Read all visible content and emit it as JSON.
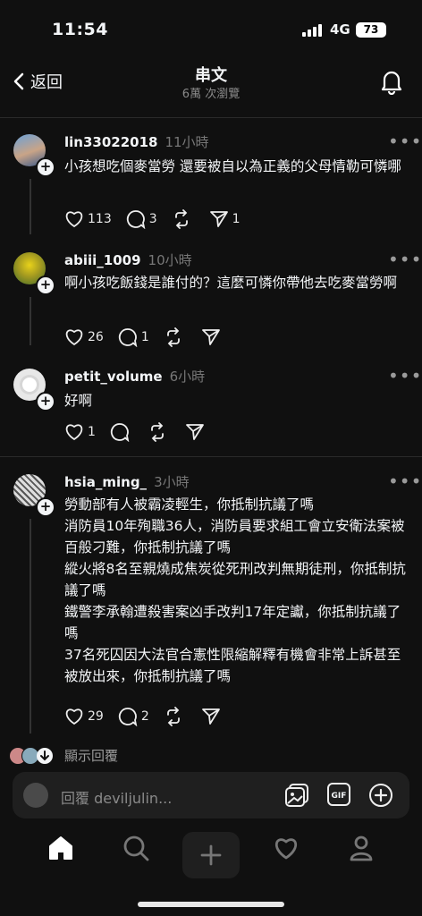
{
  "status_bar": {
    "time": "11:54",
    "network": "4G",
    "battery": "73"
  },
  "header": {
    "back_label": "返回",
    "title": "串文",
    "subtitle": "6萬 次瀏覽"
  },
  "replies": [
    {
      "username": "lin33022018",
      "time": "11小時",
      "text": "小孩想吃個麥當勞 還要被自以為正義的父母情勒可憐哪",
      "likes": "113",
      "comments": "3",
      "reposts": "",
      "shares": "1"
    },
    {
      "username": "abiii_1009",
      "time": "10小時",
      "text": "啊小孩吃飯錢是誰付的？這麼可憐你帶他去吃麥當勞啊",
      "likes": "26",
      "comments": "1",
      "reposts": "",
      "shares": ""
    },
    {
      "username": "petit_volume",
      "time": "6小時",
      "text": "好啊",
      "likes": "1",
      "comments": "",
      "reposts": "",
      "shares": ""
    },
    {
      "username": "hsia_ming_",
      "time": "3小時",
      "lines": [
        "勞動部有人被霸凌輕生，你抵制抗議了嗎",
        "消防員10年殉職36人，消防員要求組工會立安衛法案被百般刁難，你抵制抗議了嗎",
        "縱火將8名至親燒成焦炭從死刑改判無期徒刑，你抵制抗議了嗎",
        "鐵警李承翰遭殺害案凶手改判17年定讞，你抵制抗議了嗎",
        "37名死囚因大法官合憲性限縮解釋有機會非常上訴甚至被放出來，你抵制抗議了嗎"
      ],
      "likes": "29",
      "comments": "2",
      "reposts": "",
      "shares": ""
    }
  ],
  "show_replies_label": "顯示回覆",
  "reply_input": {
    "placeholder": "回覆 deviljulin..."
  },
  "tab_bar": {
    "items": [
      "home-tab",
      "search-tab",
      "create-tab",
      "activity-tab",
      "profile-tab"
    ]
  },
  "colors": {
    "background": "#101010",
    "text": "#f3f5f7",
    "muted": "#777777",
    "divider": "#2a2a2a"
  }
}
